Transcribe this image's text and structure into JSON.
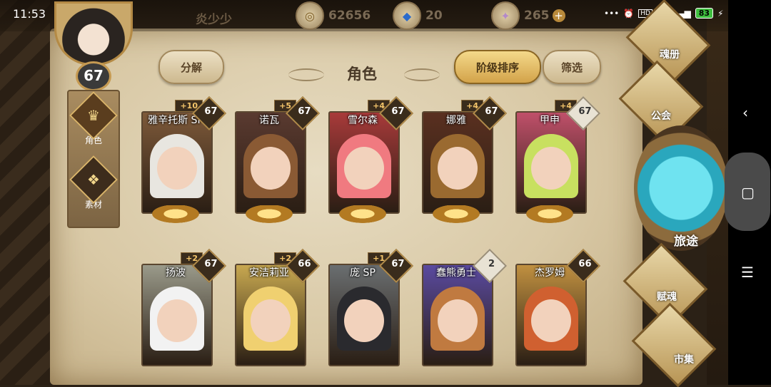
{
  "status": {
    "time": "11:53",
    "battery": "83",
    "network": "4G"
  },
  "player": {
    "name": "炎少少",
    "level": "67"
  },
  "currencies": [
    {
      "icon": "gold-coin-icon",
      "value": "62656"
    },
    {
      "icon": "blue-crystal-icon",
      "value": "20"
    },
    {
      "icon": "diamond-ore-icon",
      "value": "265"
    }
  ],
  "side_nav": [
    {
      "label": "角色"
    },
    {
      "label": "素材"
    }
  ],
  "toolbar": {
    "decompose": "分解",
    "title": "角色",
    "sort": "阶级排序",
    "filter": "筛选"
  },
  "right_menu": {
    "soul_book": "魂册",
    "guild": "公会",
    "journey": "旅途",
    "soul_gift": "赋魂",
    "market": "市集"
  },
  "characters": [
    {
      "name": "雅辛托斯 SP",
      "level": "67",
      "plus": "+10",
      "hair": "#e8e6e0",
      "bg": "#7e5a3a"
    },
    {
      "name": "诺瓦",
      "level": "67",
      "plus": "+5",
      "hair": "#8a5a34",
      "bg": "#5a3a30"
    },
    {
      "name": "雪尔森",
      "level": "67",
      "plus": "+4",
      "hair": "#f07a80",
      "bg": "#a83a3a"
    },
    {
      "name": "娜雅",
      "level": "67",
      "plus": "+4",
      "hair": "#9a6a30",
      "bg": "#5a3020"
    },
    {
      "name": "甲申",
      "level": "67",
      "plus": "+4",
      "hair": "#c8e060",
      "bg": "#c0506a"
    },
    {
      "name": "扬波",
      "level": "67",
      "plus": "+2",
      "hair": "#f2f2f2",
      "bg": "#9a9a8a"
    },
    {
      "name": "安洁莉亚",
      "level": "66",
      "plus": "+2",
      "hair": "#f0d070",
      "bg": "#c8a850"
    },
    {
      "name": "庞 SP",
      "level": "67",
      "plus": "+1",
      "hair": "#2a2a2e",
      "bg": "#6a6e70"
    },
    {
      "name": "蠢熊勇士",
      "level": "2",
      "plus": "",
      "hair": "#c07a40",
      "bg": "#5a4aa0"
    },
    {
      "name": "杰罗姆",
      "level": "66",
      "plus": "",
      "hair": "#d06030",
      "bg": "#c09040"
    }
  ]
}
